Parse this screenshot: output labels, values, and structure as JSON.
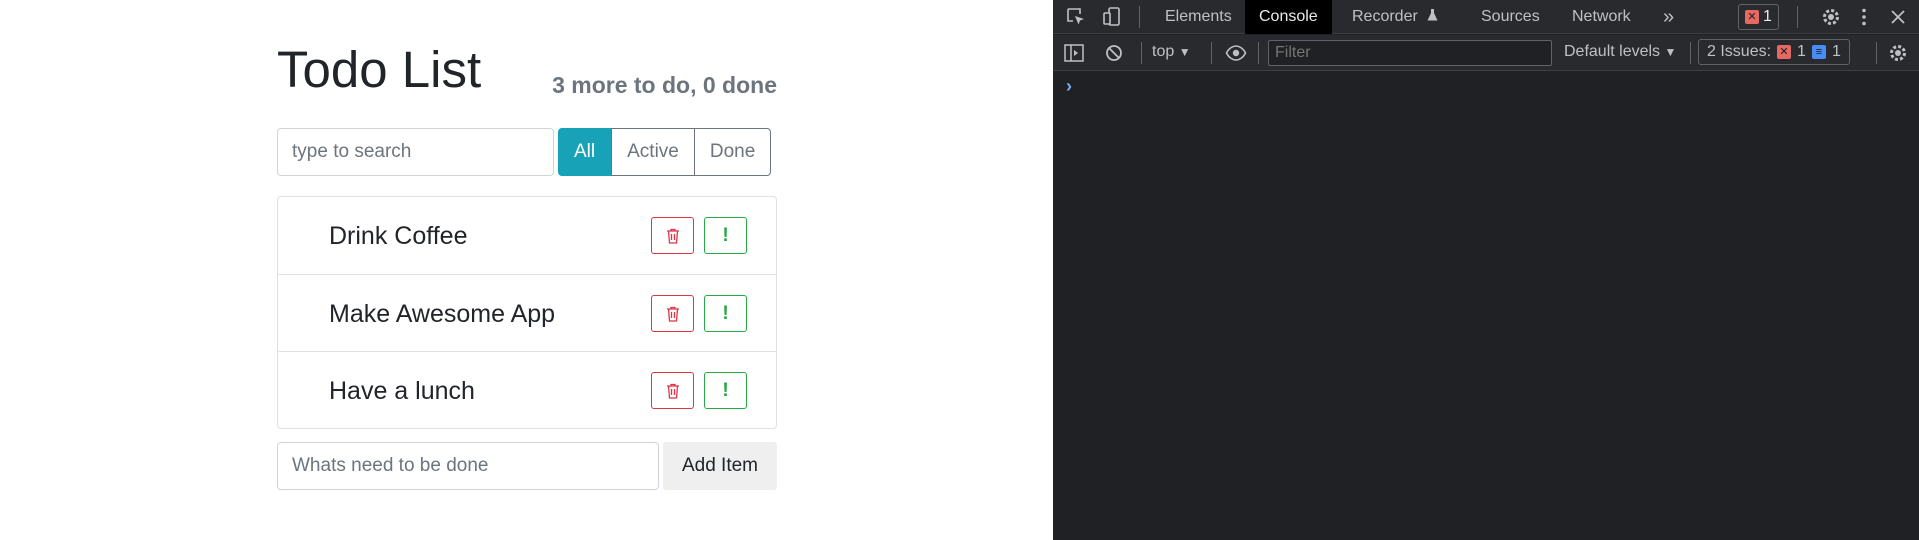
{
  "app": {
    "title": "Todo List",
    "counts": "3 more to do, 0 done",
    "search_placeholder": "type to search",
    "filters": [
      "All",
      "Active",
      "Done"
    ],
    "items": [
      {
        "label": "Drink Coffee"
      },
      {
        "label": "Make Awesome App"
      },
      {
        "label": "Have a lunch"
      }
    ],
    "add_placeholder": "Whats need to be done",
    "add_button": "Add Item",
    "colors": {
      "accent": "#17a2b8",
      "danger": "#dc3545",
      "success": "#28a745"
    }
  },
  "devtools": {
    "tabs": [
      "Elements",
      "Console",
      "Recorder",
      "Sources",
      "Network"
    ],
    "active_tab": "Console",
    "error_count": "1",
    "context": "top",
    "filter_placeholder": "Filter",
    "levels": "Default levels",
    "issues_label": "2 Issues:",
    "issues_errors": "1",
    "issues_info": "1",
    "prompt": "›"
  }
}
